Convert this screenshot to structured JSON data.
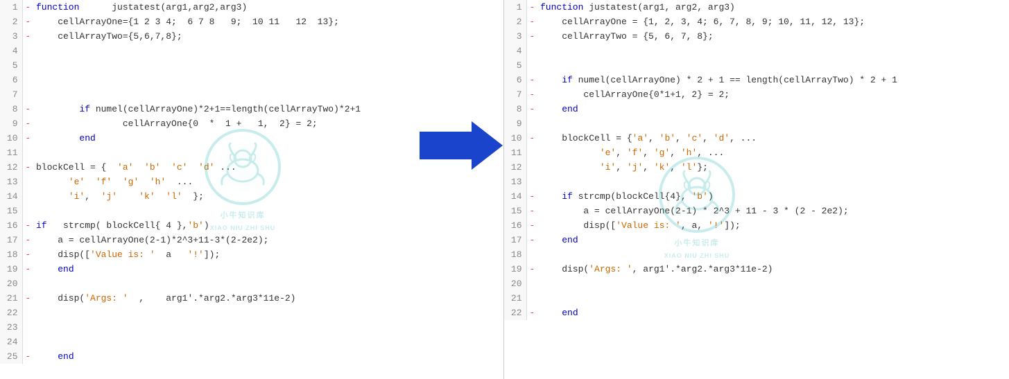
{
  "left_panel": {
    "lines": [
      {
        "num": 1,
        "indicator": "-",
        "content": "<span class='kw'>function</span>      justatest(arg1,arg2,arg3)"
      },
      {
        "num": 2,
        "indicator": "-",
        "content": "    cellArrayOne={1 2 3 4;  6 7 8   9;  10 11   12  13};"
      },
      {
        "num": 3,
        "indicator": "-",
        "content": "    cellArrayTwo={5,6,7,8};"
      },
      {
        "num": 4,
        "indicator": "",
        "content": ""
      },
      {
        "num": 5,
        "indicator": "",
        "content": ""
      },
      {
        "num": 6,
        "indicator": "",
        "content": ""
      },
      {
        "num": 7,
        "indicator": "",
        "content": ""
      },
      {
        "num": 8,
        "indicator": "-",
        "content": "        <span class='kw'>if</span> numel(cellArrayOne)*2+1==length(cellArrayTwo)*2+1"
      },
      {
        "num": 9,
        "indicator": "-",
        "content": "                cellArrayOne{0  *  1 +   1,  2} = 2;"
      },
      {
        "num": 10,
        "indicator": "-",
        "content": "        <span class='kw'>end</span>"
      },
      {
        "num": 11,
        "indicator": "",
        "content": ""
      },
      {
        "num": 12,
        "indicator": "-",
        "content": "blockCell = {  <span class='str'>'a'</span>  <span class='str'>'b'</span>  <span class='str'>'c'</span>  <span class='str'>'d'</span> ..."
      },
      {
        "num": 13,
        "indicator": "",
        "content": "      <span class='str'>'e'</span>  <span class='str'>'f'</span>  <span class='str'>'g'</span>  <span class='str'>'h'</span>  ..."
      },
      {
        "num": 14,
        "indicator": "",
        "content": "      <span class='str'>'i'</span>,  <span class='str'>'j'</span>    <span class='str'>'k'</span>  <span class='str'>'l'</span>  };"
      },
      {
        "num": 15,
        "indicator": "",
        "content": ""
      },
      {
        "num": 16,
        "indicator": "-",
        "content": "<span class='kw'>if</span>   strcmp( blockCell{ 4 },<span class='str'>'b'</span>)"
      },
      {
        "num": 17,
        "indicator": "-",
        "content": "    a = cellArrayOne(2-1)*2^3+11-3*(2-2e2);"
      },
      {
        "num": 18,
        "indicator": "-",
        "content": "    disp([<span class='str'>'Value is: '</span>  a   <span class='str'>'!'</span>]);"
      },
      {
        "num": 19,
        "indicator": "-",
        "content": "    <span class='kw'>end</span>"
      },
      {
        "num": 20,
        "indicator": "",
        "content": ""
      },
      {
        "num": 21,
        "indicator": "-",
        "content": "    disp(<span class='str'>'Args: '</span>  ,    arg1'.*arg2.*arg3*11e-2)"
      },
      {
        "num": 22,
        "indicator": "",
        "content": ""
      },
      {
        "num": 23,
        "indicator": "",
        "content": ""
      },
      {
        "num": 24,
        "indicator": "",
        "content": ""
      },
      {
        "num": 25,
        "indicator": "-",
        "content": "    <span class='kw'>end</span>"
      }
    ]
  },
  "right_panel": {
    "lines": [
      {
        "num": 1,
        "indicator": "-",
        "content": "<span class='kw'>function</span> justatest(arg1, arg2, arg3)"
      },
      {
        "num": 2,
        "indicator": "-",
        "content": "    cellArrayOne = {1, 2, 3, 4; 6, 7, 8, 9; 10, 11, 12, 13};"
      },
      {
        "num": 3,
        "indicator": "-",
        "content": "    cellArrayTwo = {5, 6, 7, 8};"
      },
      {
        "num": 4,
        "indicator": "",
        "content": ""
      },
      {
        "num": 5,
        "indicator": "",
        "content": ""
      },
      {
        "num": 6,
        "indicator": "-",
        "content": "    <span class='kw'>if</span> numel(cellArrayOne) * 2 + 1 == length(cellArrayTwo) * 2 + 1"
      },
      {
        "num": 7,
        "indicator": "-",
        "content": "        cellArrayOne{0*1+1, 2} = 2;"
      },
      {
        "num": 8,
        "indicator": "-",
        "content": "    <span class='kw'>end</span>"
      },
      {
        "num": 9,
        "indicator": "",
        "content": ""
      },
      {
        "num": 10,
        "indicator": "-",
        "content": "    blockCell = {<span class='str'>'a'</span>, <span class='str'>'b'</span>, <span class='str'>'c'</span>, <span class='str'>'d'</span>, ..."
      },
      {
        "num": 11,
        "indicator": "",
        "content": "           <span class='str'>'e'</span>, <span class='str'>'f'</span>, <span class='str'>'g'</span>, <span class='str'>'h'</span>, ..."
      },
      {
        "num": 12,
        "indicator": "",
        "content": "           <span class='str'>'i'</span>, <span class='str'>'j'</span>, <span class='str'>'k'</span>, <span class='str'>'l'</span>};"
      },
      {
        "num": 13,
        "indicator": "",
        "content": ""
      },
      {
        "num": 14,
        "indicator": "-",
        "content": "    <span class='kw'>if</span> strcmp(blockCell{4}, <span class='str'>'b'</span>)"
      },
      {
        "num": 15,
        "indicator": "-",
        "content": "        a = cellArrayOne(2-1) * 2^3 + 11 - 3 * (2 - 2e2);"
      },
      {
        "num": 16,
        "indicator": "-",
        "content": "        disp([<span class='str'>'Value is: '</span>, a, <span class='str'>'!'</span>]);"
      },
      {
        "num": 17,
        "indicator": "-",
        "content": "    <span class='kw'>end</span>"
      },
      {
        "num": 18,
        "indicator": "",
        "content": ""
      },
      {
        "num": 19,
        "indicator": "-",
        "content": "    disp(<span class='str'>'Args: '</span>, arg1'.*arg2.*arg3*11e-2)"
      },
      {
        "num": 20,
        "indicator": "",
        "content": ""
      },
      {
        "num": 21,
        "indicator": "",
        "content": ""
      },
      {
        "num": 22,
        "indicator": "-",
        "content": "    <span class='kw'>end</span>"
      }
    ]
  },
  "arrow": {
    "color": "#1a44cc"
  },
  "watermark": {
    "text": "XIAO NIU ZHI SHU",
    "circle_color": "#2ab8b8"
  }
}
